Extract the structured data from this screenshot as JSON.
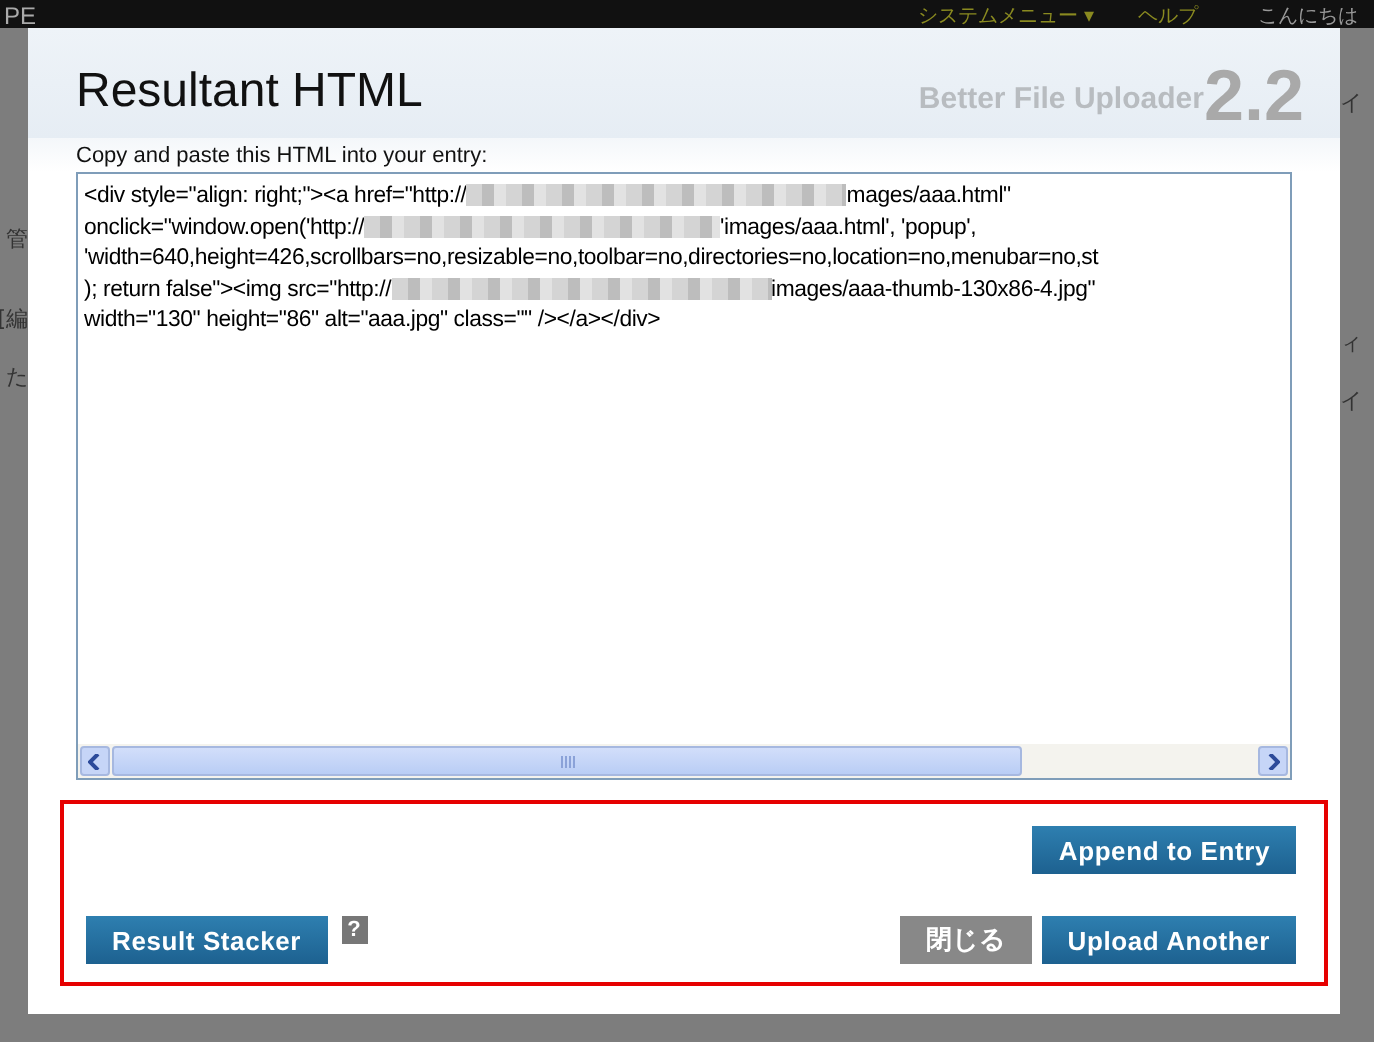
{
  "background": {
    "header_left": "PE",
    "menu": [
      {
        "label": "システムメニュー ▾"
      },
      {
        "label": "ヘルプ"
      },
      {
        "label": "こんにちは"
      }
    ],
    "left_fragments": [
      "管",
      "[編",
      "た"
    ],
    "right_fragments": [
      "イ",
      "ィ",
      "イ"
    ]
  },
  "dialog": {
    "title": "Resultant HTML",
    "brand": "Better File Uploader",
    "version": "2.2",
    "instruction": "Copy and paste this HTML into your entry:",
    "code_lines": [
      [
        {
          "kind": "text",
          "text": "<div style=\"align: right;\"><a href=\"http://"
        },
        {
          "kind": "blur"
        },
        {
          "kind": "text",
          "text": "mages/aaa.html\""
        }
      ],
      [
        {
          "kind": "text",
          "text": "onclick=\"window.open('http://"
        },
        {
          "kind": "blur"
        },
        {
          "kind": "text",
          "text": "'images/aaa.html', 'popup',"
        }
      ],
      [
        {
          "kind": "text",
          "text": "'width=640,height=426,scrollbars=no,resizable=no,toolbar=no,directories=no,location=no,menubar=no,st"
        }
      ],
      [
        {
          "kind": "text",
          "text": "); return false\"><img src=\"http://"
        },
        {
          "kind": "blur"
        },
        {
          "kind": "text",
          "text": "images/aaa-thumb-130x86-4.jpg\""
        }
      ],
      [
        {
          "kind": "text",
          "text": "width=\"130\" height=\"86\" alt=\"aaa.jpg\" class=\"\" /></a></div>"
        }
      ]
    ],
    "append_button": "Append to Entry",
    "stacker_button": "Result Stacker",
    "help": "?",
    "close_button": {
      "label": "閉じる",
      "disabled": true
    },
    "upload_button": "Upload Another"
  }
}
